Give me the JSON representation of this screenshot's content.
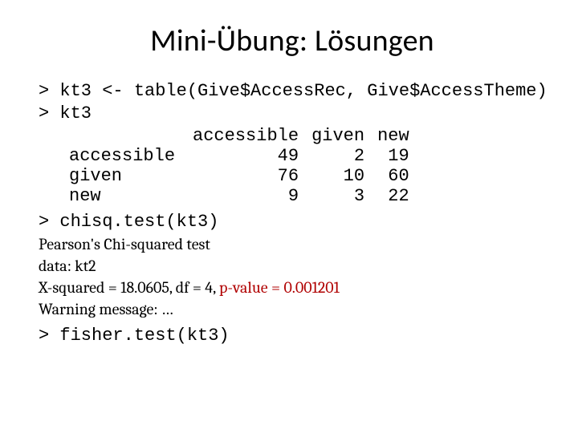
{
  "title": "Mini-Übung: Lösungen",
  "code": {
    "line1": "> kt3 <- table(Give$AccessRec, Give$AccessTheme)",
    "line2": "> kt3",
    "chisq_call": "> chisq.test(kt3)",
    "fisher_call": "> fisher.test(kt3)"
  },
  "table": {
    "col_headers": [
      "accessible",
      "given",
      "new"
    ],
    "rows": [
      {
        "label": "accessible",
        "vals": [
          "49",
          "2",
          "19"
        ]
      },
      {
        "label": "given",
        "vals": [
          "76",
          "10",
          "60"
        ]
      },
      {
        "label": "new",
        "vals": [
          "9",
          "3",
          "22"
        ]
      }
    ]
  },
  "chisq": {
    "title": "  Pearson's Chi-squared test",
    "data_line": "data:  kt2",
    "stat_prefix": "X-squared = 18.0605, df = 4, ",
    "pval_label": "p-value = 0.001201",
    "warn": "Warning message: …"
  }
}
